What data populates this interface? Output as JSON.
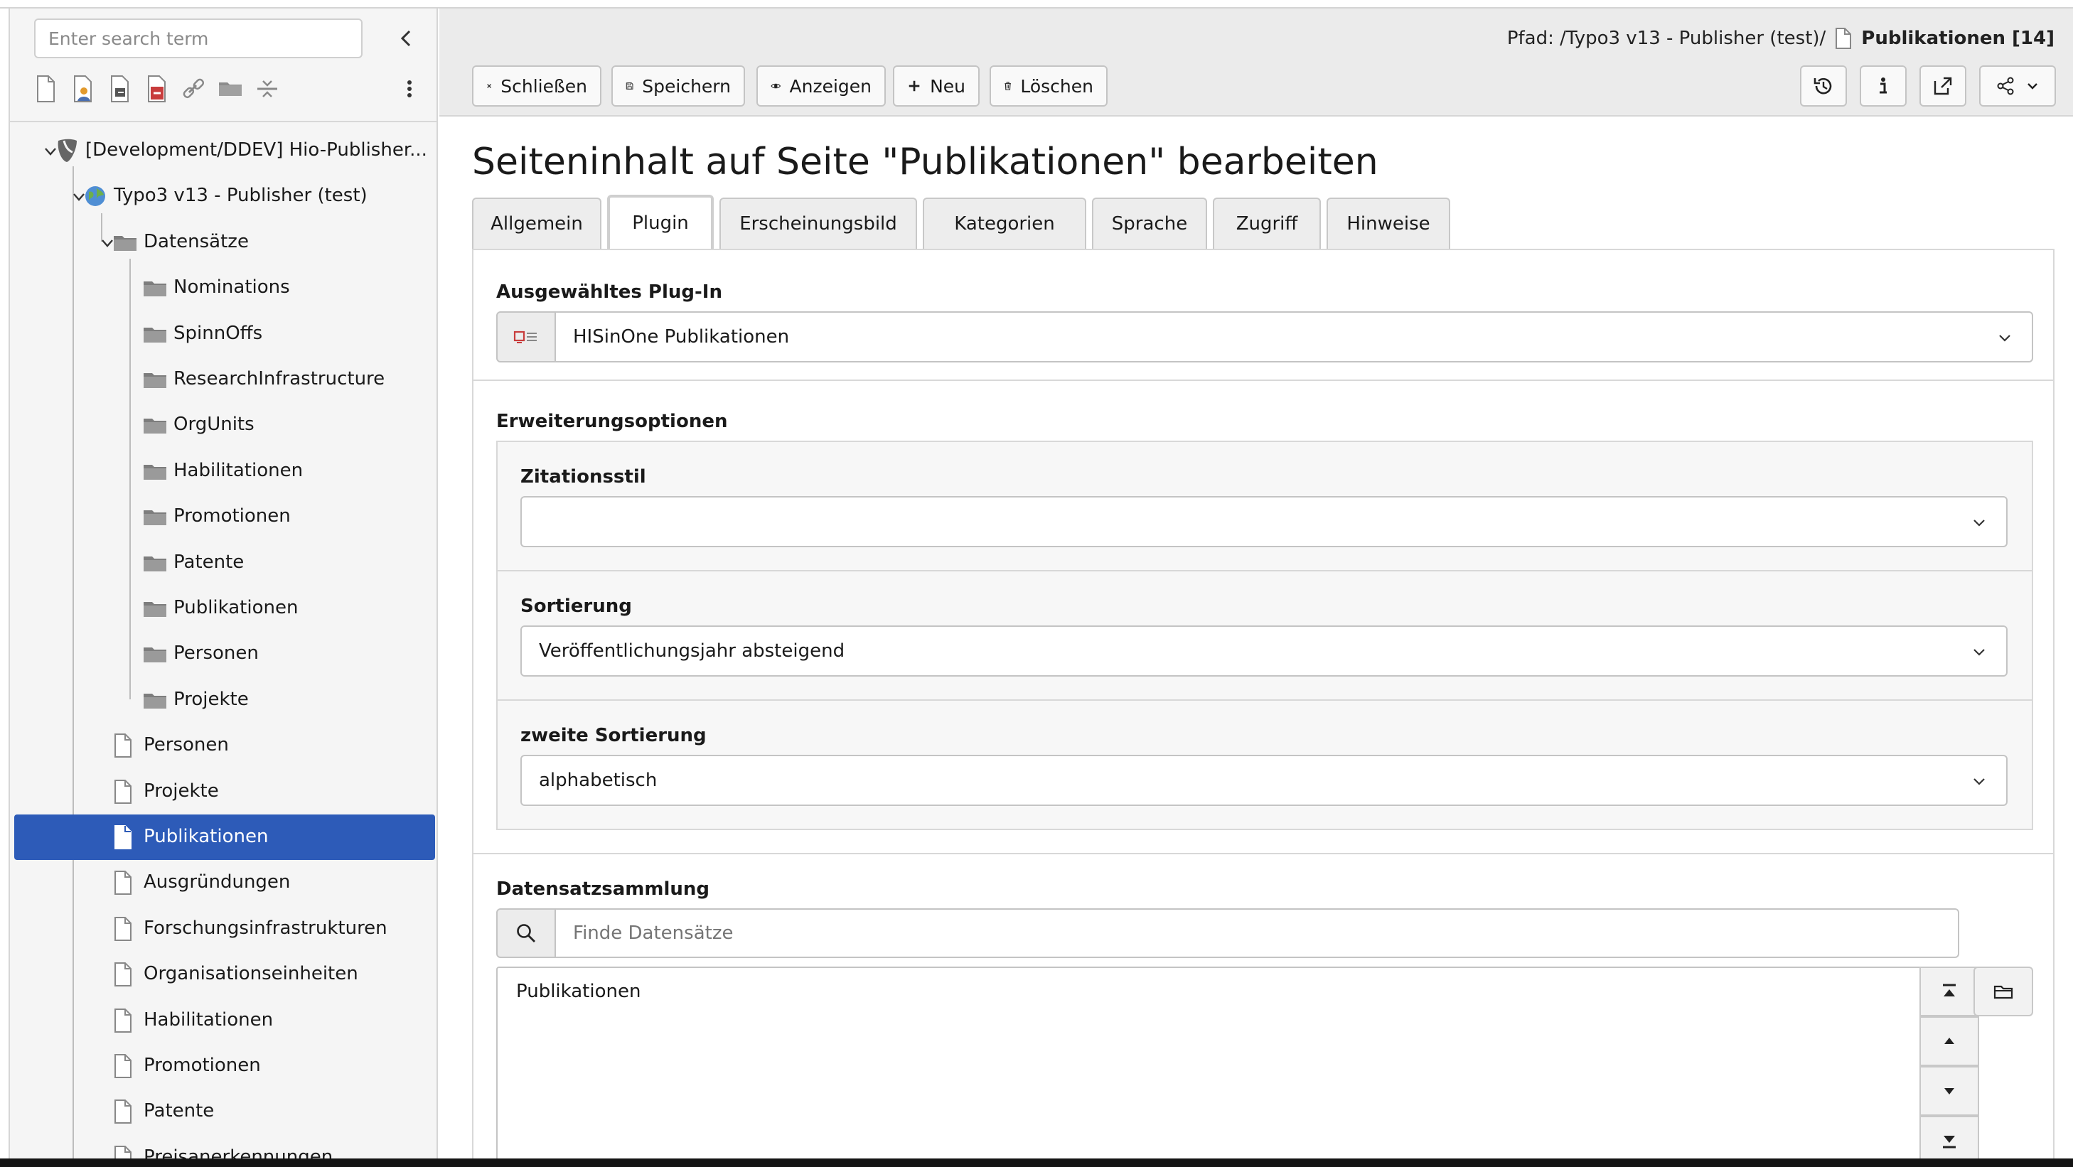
{
  "sidebar": {
    "search_placeholder": "Enter search term",
    "toolbar_icons": [
      "new-page-icon",
      "page-user-icon",
      "page-link-icon",
      "page-delete-icon",
      "link-icon",
      "folder-icon",
      "divider-icon",
      "more-vertical-icon"
    ],
    "tree": [
      {
        "label": "[Development/DDEV] Hio-Publisher...",
        "icon": "typo3-logo-icon"
      },
      {
        "label": "Typo3 v13 - Publisher (test)",
        "icon": "globe-icon"
      },
      {
        "label": "Datensätze",
        "icon": "folder-icon"
      },
      {
        "label": "Nominations",
        "icon": "folder-icon"
      },
      {
        "label": "SpinnOffs",
        "icon": "folder-icon"
      },
      {
        "label": "ResearchInfrastructure",
        "icon": "folder-icon"
      },
      {
        "label": "OrgUnits",
        "icon": "folder-icon"
      },
      {
        "label": "Habilitationen",
        "icon": "folder-icon"
      },
      {
        "label": "Promotionen",
        "icon": "folder-icon"
      },
      {
        "label": "Patente",
        "icon": "folder-icon"
      },
      {
        "label": "Publikationen",
        "icon": "folder-icon"
      },
      {
        "label": "Personen",
        "icon": "folder-icon"
      },
      {
        "label": "Projekte",
        "icon": "folder-icon"
      },
      {
        "label": "Personen",
        "icon": "page-icon"
      },
      {
        "label": "Projekte",
        "icon": "page-icon"
      },
      {
        "label": "Publikationen",
        "icon": "page-icon",
        "selected": true
      },
      {
        "label": "Ausgründungen",
        "icon": "page-icon"
      },
      {
        "label": "Forschungsinfrastrukturen",
        "icon": "page-icon"
      },
      {
        "label": "Organisationseinheiten",
        "icon": "page-icon"
      },
      {
        "label": "Habilitationen",
        "icon": "page-icon"
      },
      {
        "label": "Promotionen",
        "icon": "page-icon"
      },
      {
        "label": "Patente",
        "icon": "page-icon"
      },
      {
        "label": "Preisanerkennungen",
        "icon": "page-icon"
      }
    ]
  },
  "header": {
    "path_prefix": "Pfad: /Typo3 v13 - Publisher (test)/",
    "path_page": "Publikationen [14]",
    "buttons": {
      "close": "Schließen",
      "save": "Speichern",
      "view": "Anzeigen",
      "new": "Neu",
      "delete": "Löschen"
    },
    "right_icons": [
      "history-icon",
      "info-icon",
      "open-new-window-icon",
      "share-icon"
    ]
  },
  "page_title": "Seiteninhalt auf Seite \"Publikationen\" bearbeiten",
  "tabs": [
    "Allgemein",
    "Plugin",
    "Erscheinungsbild",
    "Kategorien",
    "Sprache",
    "Zugriff",
    "Hinweise"
  ],
  "active_tab": "Plugin",
  "form": {
    "plugin_label": "Ausgewähltes Plug-In",
    "plugin_value": "HISinOne Publikationen",
    "extension_label": "Erweiterungsoptionen",
    "citation_label": "Zitationsstil",
    "citation_value": "",
    "sort_label": "Sortierung",
    "sort_value": "Veröffentlichungsjahr absteigend",
    "sort2_label": "zweite Sortierung",
    "sort2_value": "alphabetisch",
    "records_label": "Datensatzsammlung",
    "records_placeholder": "Finde Datensätze",
    "records_items": [
      "Publikationen"
    ]
  }
}
